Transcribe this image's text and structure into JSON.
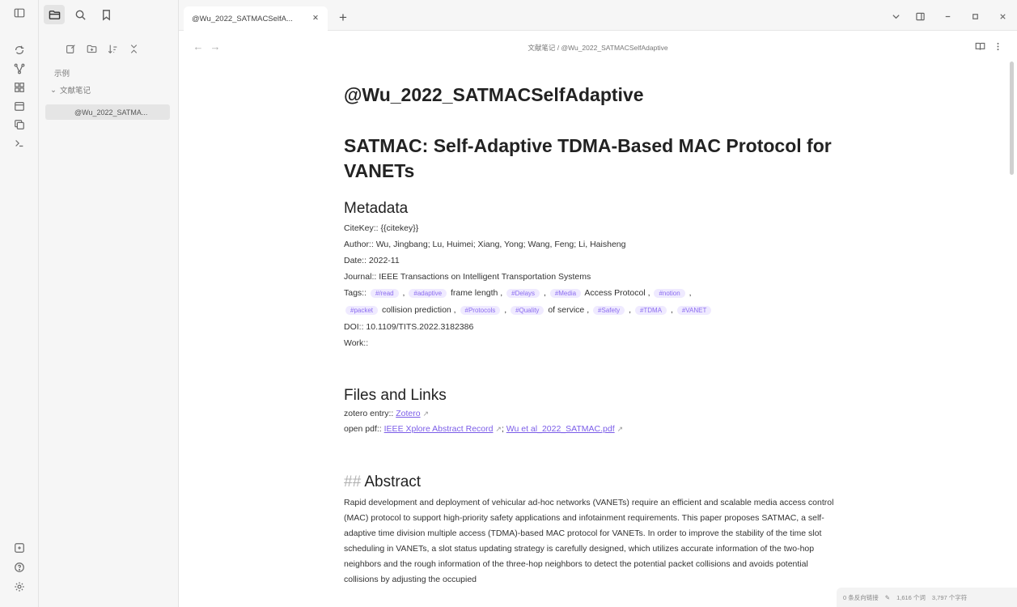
{
  "tab": {
    "title": "@Wu_2022_SATMACSelfA...",
    "close_label": "✕",
    "new_label": "+"
  },
  "breadcrumb": "文献笔记 / @Wu_2022_SATMACSelfAdaptive",
  "sidebar": {
    "items": [
      {
        "label": "示例"
      },
      {
        "label": "文献笔记"
      },
      {
        "label": "@Wu_2022_SATMA..."
      }
    ]
  },
  "doc": {
    "title": "@Wu_2022_SATMACSelfAdaptive",
    "subtitle": "SATMAC: Self-Adaptive TDMA-Based MAC Protocol for VANETs",
    "metadata_heading": "Metadata",
    "citekey": "CiteKey:: {{citekey}}",
    "author": "Author:: Wu, Jingbang; Lu, Huimei; Xiang, Yong; Wang, Feng; Li, Haisheng",
    "date": "Date:: 2022-11",
    "journal": "Journal:: IEEE Transactions on Intelligent Transportation Systems",
    "tags_label": "Tags::",
    "tags_line1": [
      {
        "tag": "#/read",
        "after": ","
      },
      {
        "tag": "#adaptive",
        "after": "frame length ,"
      },
      {
        "tag": "#Delays",
        "after": ","
      },
      {
        "tag": "#Media",
        "after": "Access Protocol ,"
      },
      {
        "tag": "#notion",
        "after": ","
      }
    ],
    "tags_line2": [
      {
        "tag": "#packet",
        "after": "collision prediction ,"
      },
      {
        "tag": "#Protocols",
        "after": ","
      },
      {
        "tag": "#Quality",
        "after": "of service ,"
      },
      {
        "tag": "#Safety",
        "after": ","
      },
      {
        "tag": "#TDMA",
        "after": ","
      },
      {
        "tag": "#VANET",
        "after": ""
      }
    ],
    "doi": "DOI:: 10.1109/TITS.2022.3182386",
    "work": "Work::",
    "files_heading": "Files and Links",
    "zotero_prefix": "zotero entry::",
    "zotero_link": "Zotero",
    "pdf_prefix": "open pdf::",
    "pdf_link1": "IEEE Xplore Abstract Record",
    "pdf_sep": ";",
    "pdf_link2": "Wu et al_2022_SATMAC.pdf",
    "abstract_hash": "##",
    "abstract_heading": "Abstract",
    "abstract_text": "Rapid development and deployment of vehicular ad-hoc networks (VANETs) require an efficient and scalable media access control (MAC) protocol to support high-priority safety applications and infotainment requirements. This paper proposes SATMAC, a self-adaptive time division multiple access (TDMA)-based MAC protocol for VANETs. In order to improve the stability of the time slot scheduling in VANETs, a slot status updating strategy is carefully designed, which utilizes accurate information of the two-hop neighbors and the rough information of the three-hop neighbors to detect the potential packet collisions and avoids potential collisions by adjusting the occupied"
  },
  "status": {
    "backlinks": "0 条反向链接",
    "words": "1,616 个词",
    "chars": "3,797 个字符"
  }
}
